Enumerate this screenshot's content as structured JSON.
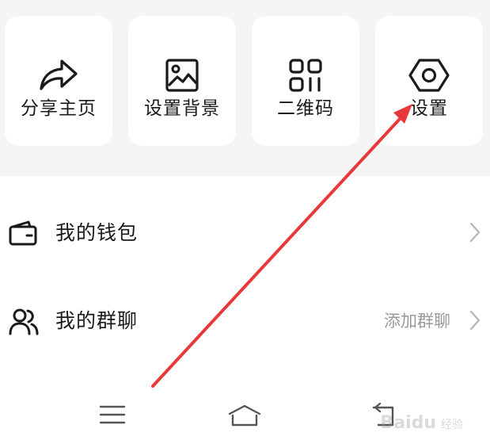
{
  "quick_actions": [
    {
      "label": "分享主页",
      "icon": "share-icon"
    },
    {
      "label": "设置背景",
      "icon": "image-icon"
    },
    {
      "label": "二维码",
      "icon": "qr-code-icon"
    },
    {
      "label": "设置",
      "icon": "gear-icon"
    }
  ],
  "menu": {
    "wallet": {
      "label": "我的钱包",
      "icon": "wallet-icon"
    },
    "groups": {
      "label": "我的群聊",
      "hint": "添加群聊",
      "icon": "users-icon"
    }
  },
  "nav": {
    "items": [
      "menu-icon",
      "home-icon",
      "back-icon"
    ]
  },
  "watermark": {
    "text": "Baidu",
    "subtext": "经验"
  },
  "colors": {
    "panel_bg": "#f5f5f5",
    "tile_bg": "#ffffff",
    "text": "#1a1a1a",
    "hint": "#9a9a9a",
    "annotation_arrow": "#e8393a"
  }
}
